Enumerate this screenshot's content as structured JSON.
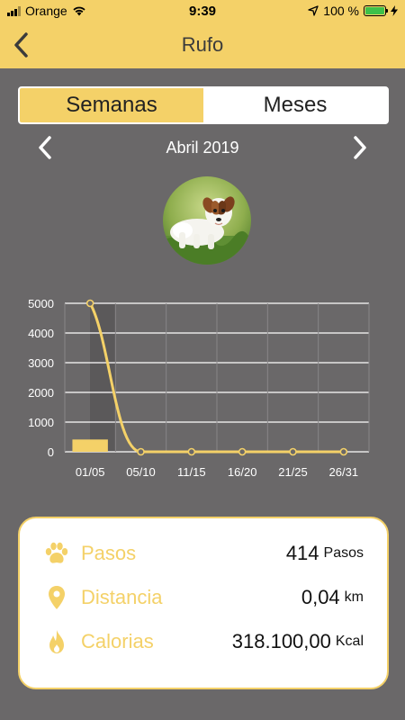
{
  "status_bar": {
    "carrier": "Orange",
    "time": "9:39",
    "battery_text": "100 %",
    "battery_level": 1.0
  },
  "nav": {
    "title": "Rufo"
  },
  "segmented": {
    "weeks_label": "Semanas",
    "months_label": "Meses",
    "selected": "weeks"
  },
  "period": {
    "label": "Abril 2019"
  },
  "avatar": {
    "alt": "dog photo"
  },
  "colors": {
    "accent": "#f4d168",
    "background": "#6a6869",
    "text_dark": "#3b3b3b"
  },
  "chart_data": {
    "type": "bar",
    "categories": [
      "01/05",
      "05/10",
      "11/15",
      "16/20",
      "21/25",
      "26/31"
    ],
    "values": [
      414,
      0,
      0,
      0,
      0,
      0
    ],
    "series": [
      {
        "type": "bar",
        "values": [
          414,
          0,
          0,
          0,
          0,
          0
        ]
      },
      {
        "type": "line",
        "values": [
          5000,
          0,
          0,
          0,
          0,
          0
        ]
      }
    ],
    "y_ticks": [
      "0",
      "1000",
      "2000",
      "3000",
      "4000",
      "5000"
    ],
    "ylim": [
      0,
      5000
    ],
    "grid": true,
    "title": "",
    "xlabel": "",
    "ylabel": ""
  },
  "stats": [
    {
      "icon": "paw-icon",
      "label": "Pasos",
      "value": "414",
      "unit": "Pasos"
    },
    {
      "icon": "location-pin-icon",
      "label": "Distancia",
      "value": "0,04",
      "unit": "km"
    },
    {
      "icon": "flame-icon",
      "label": "Calorias",
      "value": "318.100,00",
      "unit": "Kcal"
    }
  ]
}
